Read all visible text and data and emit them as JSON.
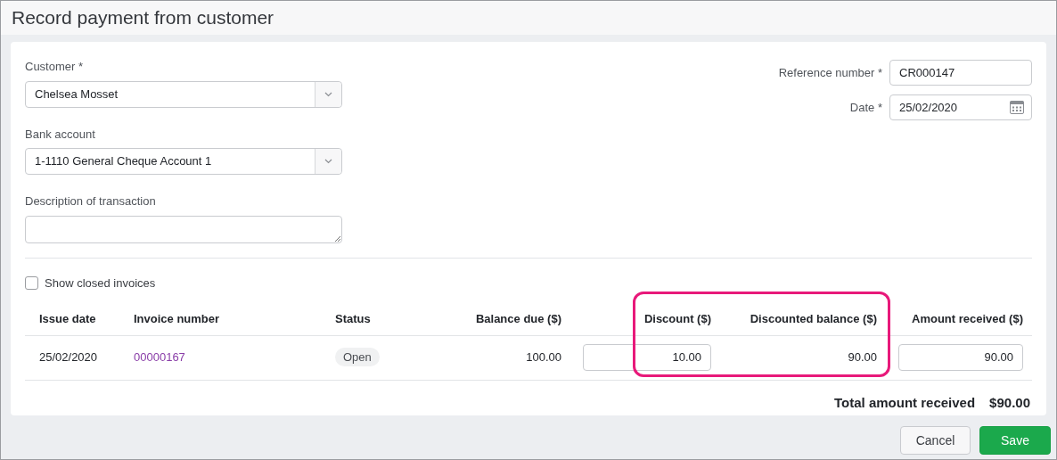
{
  "window": {
    "title": "Record payment from customer"
  },
  "form": {
    "customer": {
      "label": "Customer *",
      "value": "Chelsea Mosset"
    },
    "bank_account": {
      "label": "Bank account",
      "value": "1-1110 General Cheque Account 1"
    },
    "description": {
      "label": "Description of transaction"
    },
    "reference_number": {
      "label": "Reference number *",
      "value": "CR000147"
    },
    "date": {
      "label": "Date *",
      "value": "25/02/2020"
    }
  },
  "show_closed_invoices": {
    "label": "Show closed invoices",
    "checked": false
  },
  "table": {
    "columns": [
      "Issue date",
      "Invoice number",
      "Status",
      "Balance due ($)",
      "Discount ($)",
      "Discounted balance ($)",
      "Amount received ($)"
    ],
    "rows": [
      {
        "issue_date": "25/02/2020",
        "invoice_number": "00000167",
        "status": "Open",
        "balance_due": "100.00",
        "discount": "10.00",
        "discounted_balance": "90.00",
        "amount_received": "90.00"
      }
    ],
    "highlighted_columns": true
  },
  "total": {
    "label": "Total amount received",
    "value": "$90.00"
  },
  "buttons": [
    {
      "label": "Cancel",
      "kind": "secondary"
    },
    {
      "label": "Save",
      "kind": "primary"
    }
  ]
}
